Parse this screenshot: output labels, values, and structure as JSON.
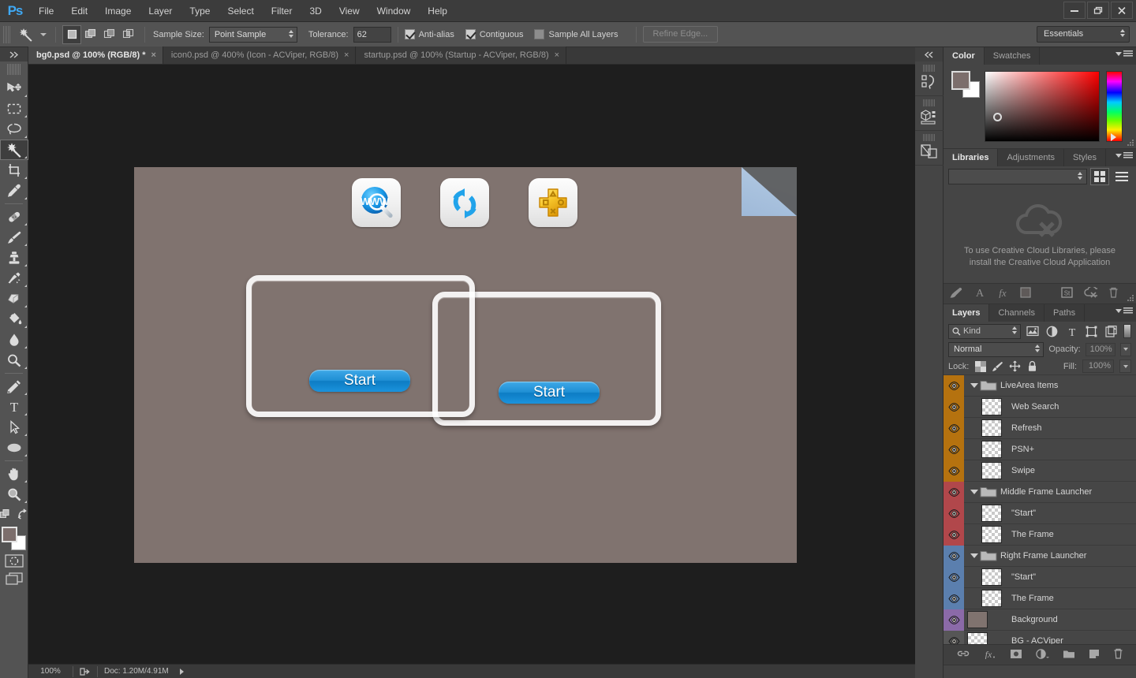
{
  "app": {
    "logo": "Ps",
    "menus": [
      "File",
      "Edit",
      "Image",
      "Layer",
      "Type",
      "Select",
      "Filter",
      "3D",
      "View",
      "Window",
      "Help"
    ],
    "window_controls": {
      "minimize": "minimize-icon",
      "restore": "restore-icon",
      "close": "close-icon"
    }
  },
  "options_bar": {
    "tool_icon": "magic-wand-icon",
    "selection_modes": [
      "new-selection",
      "add-to-selection",
      "subtract-from-selection",
      "intersect-with-selection"
    ],
    "selection_mode_active": 0,
    "sample_size_label": "Sample Size:",
    "sample_size_value": "Point Sample",
    "tolerance_label": "Tolerance:",
    "tolerance_value": "62",
    "anti_alias_label": "Anti-alias",
    "anti_alias_checked": true,
    "contiguous_label": "Contiguous",
    "contiguous_checked": true,
    "sample_all_layers_label": "Sample All Layers",
    "sample_all_layers_checked": false,
    "refine_edge_label": "Refine Edge...",
    "refine_edge_enabled": false,
    "workspace_value": "Essentials"
  },
  "toolbar": {
    "tools": [
      {
        "name": "move-tool",
        "icon": "move-icon",
        "selected": false,
        "has_corner": true
      },
      {
        "name": "rectangular-marquee-tool",
        "icon": "marquee-icon",
        "selected": false,
        "has_corner": true
      },
      {
        "name": "lasso-tool",
        "icon": "lasso-icon",
        "selected": false,
        "has_corner": true
      },
      {
        "name": "magic-wand-tool",
        "icon": "magic-wand-icon",
        "selected": true,
        "has_corner": true
      },
      {
        "name": "crop-tool",
        "icon": "crop-icon",
        "selected": false,
        "has_corner": true
      },
      {
        "name": "eyedropper-tool",
        "icon": "eyedropper-icon",
        "selected": false,
        "has_corner": true
      },
      {
        "name": "spot-healing-brush-tool",
        "icon": "healing-brush-icon",
        "selected": false,
        "has_corner": true
      },
      {
        "name": "brush-tool",
        "icon": "brush-icon",
        "selected": false,
        "has_corner": true
      },
      {
        "name": "clone-stamp-tool",
        "icon": "clone-stamp-icon",
        "selected": false,
        "has_corner": true
      },
      {
        "name": "history-brush-tool",
        "icon": "history-brush-icon",
        "selected": false,
        "has_corner": true
      },
      {
        "name": "eraser-tool",
        "icon": "eraser-icon",
        "selected": false,
        "has_corner": true
      },
      {
        "name": "gradient-tool",
        "icon": "paint-bucket-icon",
        "selected": false,
        "has_corner": true
      },
      {
        "name": "blur-tool",
        "icon": "blur-drop-icon",
        "selected": false,
        "has_corner": true
      },
      {
        "name": "dodge-tool",
        "icon": "dodge-icon",
        "selected": false,
        "has_corner": true
      },
      {
        "name": "pen-tool",
        "icon": "pen-icon",
        "selected": false,
        "has_corner": true
      },
      {
        "name": "type-tool",
        "icon": "type-icon",
        "selected": false,
        "has_corner": true
      },
      {
        "name": "path-selection-tool",
        "icon": "path-arrow-icon",
        "selected": false,
        "has_corner": true
      },
      {
        "name": "ellipse-shape-tool",
        "icon": "ellipse-icon",
        "selected": false,
        "has_corner": true
      },
      {
        "name": "hand-tool",
        "icon": "hand-icon",
        "selected": false,
        "has_corner": true
      },
      {
        "name": "zoom-tool",
        "icon": "zoom-magnifier-icon",
        "selected": false,
        "has_corner": true
      }
    ],
    "edit_toolbar_icon": "more-tools-icon",
    "swap_colors_icon": "swap-colors-icon",
    "foreground_color": "#7c6e6c",
    "background_color": "#ffffff",
    "quick_mask_icon": "quick-mask-icon",
    "screen_mode_icon": "screen-mode-icon"
  },
  "document_tabs": [
    {
      "label": "bg0.psd @ 100% (RGB/8) *",
      "active": true,
      "close": "×"
    },
    {
      "label": "icon0.psd @ 400% (Icon - ACViper, RGB/8)",
      "active": false,
      "close": "×"
    },
    {
      "label": "startup.psd @ 100% (Startup - ACViper, RGB/8)",
      "active": false,
      "close": "×"
    }
  ],
  "canvas": {
    "background_color": "#80736f",
    "livearea_icons": [
      {
        "name": "web-search-icon",
        "label": "Web Search"
      },
      {
        "name": "refresh-icon",
        "label": "Refresh"
      },
      {
        "name": "psn-plus-icon",
        "label": "PSN+"
      }
    ],
    "page_curl": "page-curl-corner",
    "frames": [
      {
        "name": "middle-frame-launcher",
        "start_label": "Start"
      },
      {
        "name": "right-frame-launcher",
        "start_label": "Start"
      }
    ]
  },
  "status_bar": {
    "zoom": "100%",
    "share_icon": "share-icon",
    "doc_info": "Doc: 1.20M/4.91M",
    "expand_icon": "play-triangle-icon"
  },
  "mini_dock": {
    "collapse_icon": "collapse-panels-icon",
    "items": [
      {
        "name": "history-panel-icon"
      },
      {
        "name": "3d-panel-icon"
      },
      {
        "name": "properties-panel-icon"
      }
    ]
  },
  "color_panel": {
    "tabs": [
      {
        "label": "Color",
        "active": true
      },
      {
        "label": "Swatches",
        "active": false
      }
    ],
    "menu_icon": "panel-menu-icon",
    "foreground_color": "#7c6e6c",
    "background_color": "#ffffff",
    "picker_field": "saturation-brightness-field",
    "hue_slider": "hue-slider"
  },
  "libraries_panel": {
    "tabs": [
      {
        "label": "Libraries",
        "active": true
      },
      {
        "label": "Adjustments",
        "active": false
      },
      {
        "label": "Styles",
        "active": false
      }
    ],
    "menu_icon": "panel-menu-icon",
    "library_select_value": "",
    "grid_view_icon": "grid-view-icon",
    "list_view_icon": "list-view-icon",
    "empty_icon": "creative-cloud-off-icon",
    "empty_message": "To use Creative Cloud Libraries, please install the Creative Cloud Application",
    "footer_icons": [
      {
        "name": "add-graphic-icon"
      },
      {
        "name": "add-character-style-icon"
      },
      {
        "name": "add-layer-style-icon"
      },
      {
        "name": "add-color-icon"
      },
      {
        "name": "add-library-from-document-icon"
      },
      {
        "name": "sync-off-icon"
      },
      {
        "name": "delete-icon"
      }
    ]
  },
  "layers_panel": {
    "tabs": [
      {
        "label": "Layers",
        "active": true
      },
      {
        "label": "Channels",
        "active": false
      },
      {
        "label": "Paths",
        "active": false
      }
    ],
    "menu_icon": "panel-menu-icon",
    "filter_kind_label": "Kind",
    "filter_search_icon": "search-icon",
    "filter_icons": [
      {
        "name": "filter-pixel-layers-icon"
      },
      {
        "name": "filter-adjustment-layers-icon"
      },
      {
        "name": "filter-type-layers-icon"
      },
      {
        "name": "filter-shape-layers-icon"
      },
      {
        "name": "filter-smart-object-layers-icon"
      }
    ],
    "filter_toggle_icon": "filter-enable-toggle",
    "blend_mode": "Normal",
    "opacity_label": "Opacity:",
    "opacity_value": "100%",
    "lock_label": "Lock:",
    "lock_icons": [
      {
        "name": "lock-transparent-pixels-icon"
      },
      {
        "name": "lock-image-pixels-icon"
      },
      {
        "name": "lock-position-icon"
      },
      {
        "name": "lock-all-icon"
      }
    ],
    "fill_label": "Fill:",
    "fill_value": "100%",
    "layers": [
      {
        "name": "LiveArea Items",
        "type": "group",
        "indent": 0,
        "color": "#b5720f",
        "thumb": "none",
        "expanded": true
      },
      {
        "name": "Web Search",
        "type": "layer",
        "indent": 1,
        "color": "#b5720f",
        "thumb": "checker"
      },
      {
        "name": "Refresh",
        "type": "layer",
        "indent": 1,
        "color": "#b5720f",
        "thumb": "checker"
      },
      {
        "name": "PSN+",
        "type": "layer",
        "indent": 1,
        "color": "#b5720f",
        "thumb": "checker"
      },
      {
        "name": "Swipe",
        "type": "layer",
        "indent": 1,
        "color": "#b5720f",
        "thumb": "checker"
      },
      {
        "name": "Middle Frame Launcher",
        "type": "group",
        "indent": 0,
        "color": "#b1474b",
        "thumb": "none",
        "expanded": true
      },
      {
        "name": "\"Start\"",
        "type": "layer",
        "indent": 1,
        "color": "#b1474b",
        "thumb": "checker"
      },
      {
        "name": "The Frame",
        "type": "layer",
        "indent": 1,
        "color": "#b1474b",
        "thumb": "checker"
      },
      {
        "name": "Right Frame Launcher",
        "type": "group",
        "indent": 0,
        "color": "#5b7fae",
        "thumb": "none",
        "expanded": true
      },
      {
        "name": "\"Start\"",
        "type": "layer",
        "indent": 1,
        "color": "#5b7fae",
        "thumb": "checker"
      },
      {
        "name": "The Frame",
        "type": "layer",
        "indent": 1,
        "color": "#5b7fae",
        "thumb": "checker"
      },
      {
        "name": "Background",
        "type": "layer",
        "indent": 0,
        "color": "#8b6aa8",
        "thumb": "solid"
      },
      {
        "name": "BG - ACViper",
        "type": "layer",
        "indent": 0,
        "color": "#565656",
        "thumb": "checker"
      }
    ],
    "footer_icons": [
      {
        "name": "link-layers-icon"
      },
      {
        "name": "add-layer-style-icon"
      },
      {
        "name": "add-layer-mask-icon"
      },
      {
        "name": "new-adjustment-layer-icon"
      },
      {
        "name": "new-group-icon"
      },
      {
        "name": "new-layer-icon"
      },
      {
        "name": "delete-layer-icon"
      }
    ]
  }
}
